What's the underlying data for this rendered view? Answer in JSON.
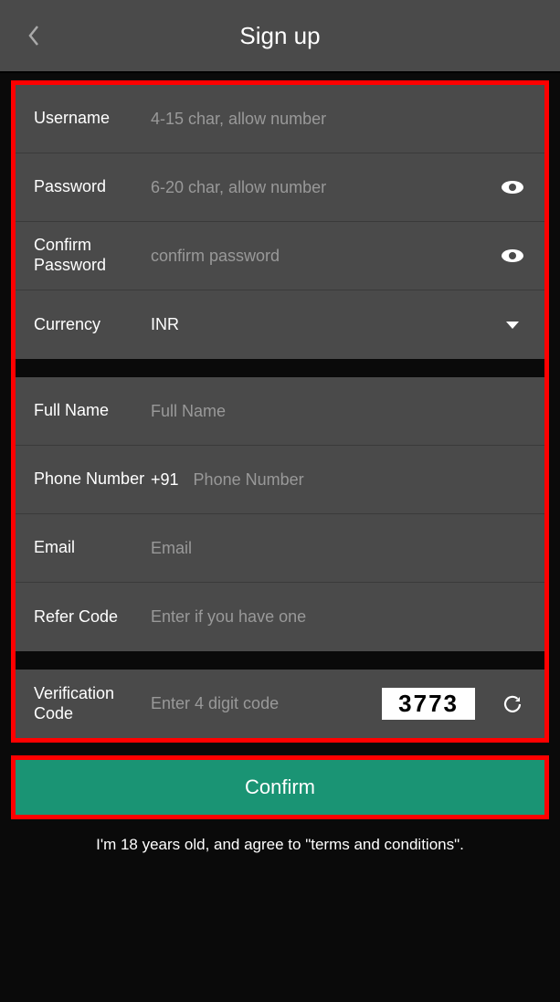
{
  "header": {
    "title": "Sign up"
  },
  "fields": {
    "username": {
      "label": "Username",
      "placeholder": "4-15 char, allow number"
    },
    "password": {
      "label": "Password",
      "placeholder": "6-20 char, allow number"
    },
    "confirm_password": {
      "label": "Confirm Password",
      "placeholder": "confirm password"
    },
    "currency": {
      "label": "Currency",
      "value": "INR"
    },
    "fullname": {
      "label": "Full Name",
      "placeholder": "Full Name"
    },
    "phone": {
      "label": "Phone Number",
      "prefix": "+91",
      "placeholder": "Phone Number"
    },
    "email": {
      "label": "Email",
      "placeholder": "Email"
    },
    "refer": {
      "label": "Refer Code",
      "placeholder": "Enter if you have one"
    },
    "verification": {
      "label": "Verification Code",
      "placeholder": "Enter 4 digit code",
      "captcha": "3773"
    }
  },
  "confirm": {
    "label": "Confirm"
  },
  "terms": {
    "text": "I'm 18 years old, and agree to \"terms and conditions\"."
  }
}
